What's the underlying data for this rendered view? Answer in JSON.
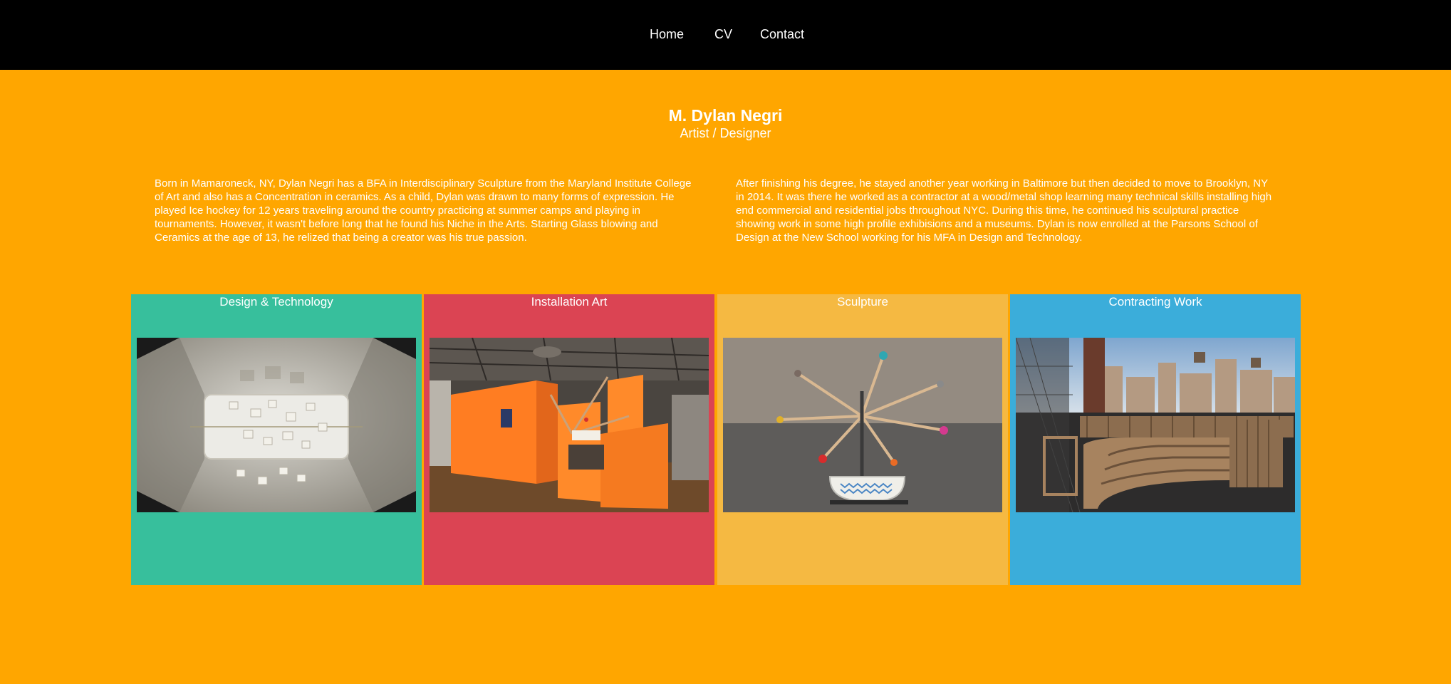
{
  "nav": {
    "items": [
      {
        "label": "Home"
      },
      {
        "label": "CV"
      },
      {
        "label": "Contact"
      }
    ]
  },
  "header": {
    "name": "M. Dylan Negri",
    "role": "Artist / Designer"
  },
  "bio": {
    "left": "Born in Mamaroneck, NY, Dylan Negri has a BFA in Interdisciplinary Sculpture from the Maryland Institute College of Art and also has a Concentration in ceramics. As a child, Dylan was drawn to many forms of expression. He played Ice hockey for 12 years traveling around the country practicing at summer camps and playing in tournaments. However, it wasn't before long that he found his Niche in the Arts. Starting Glass blowing and Ceramics at the age of 13, he relized that being a creator was his true passion.",
    "right": "After finishing his degree, he stayed another year working in Baltimore but then decided to move to Brooklyn, NY in 2014. It was there he worked as a contractor at a wood/metal shop learning many technical skills installing high end commercial and residential jobs throughout NYC. During this time, he continued his sculptural practice showing work in some high profile exhibisions and a museums. Dylan is now enrolled at the Parsons School of Design at the New School working for his MFA in Design and Technology."
  },
  "categories": [
    {
      "title": "Design & Technology",
      "color": "#37bf9c"
    },
    {
      "title": "Installation Art",
      "color": "#db4453"
    },
    {
      "title": "Sculpture",
      "color": "#f5b942"
    },
    {
      "title": "Contracting Work",
      "color": "#3badda"
    }
  ],
  "colors": {
    "nav_background": "#000000",
    "page_background": "#ffa600",
    "text": "#ffffff"
  }
}
